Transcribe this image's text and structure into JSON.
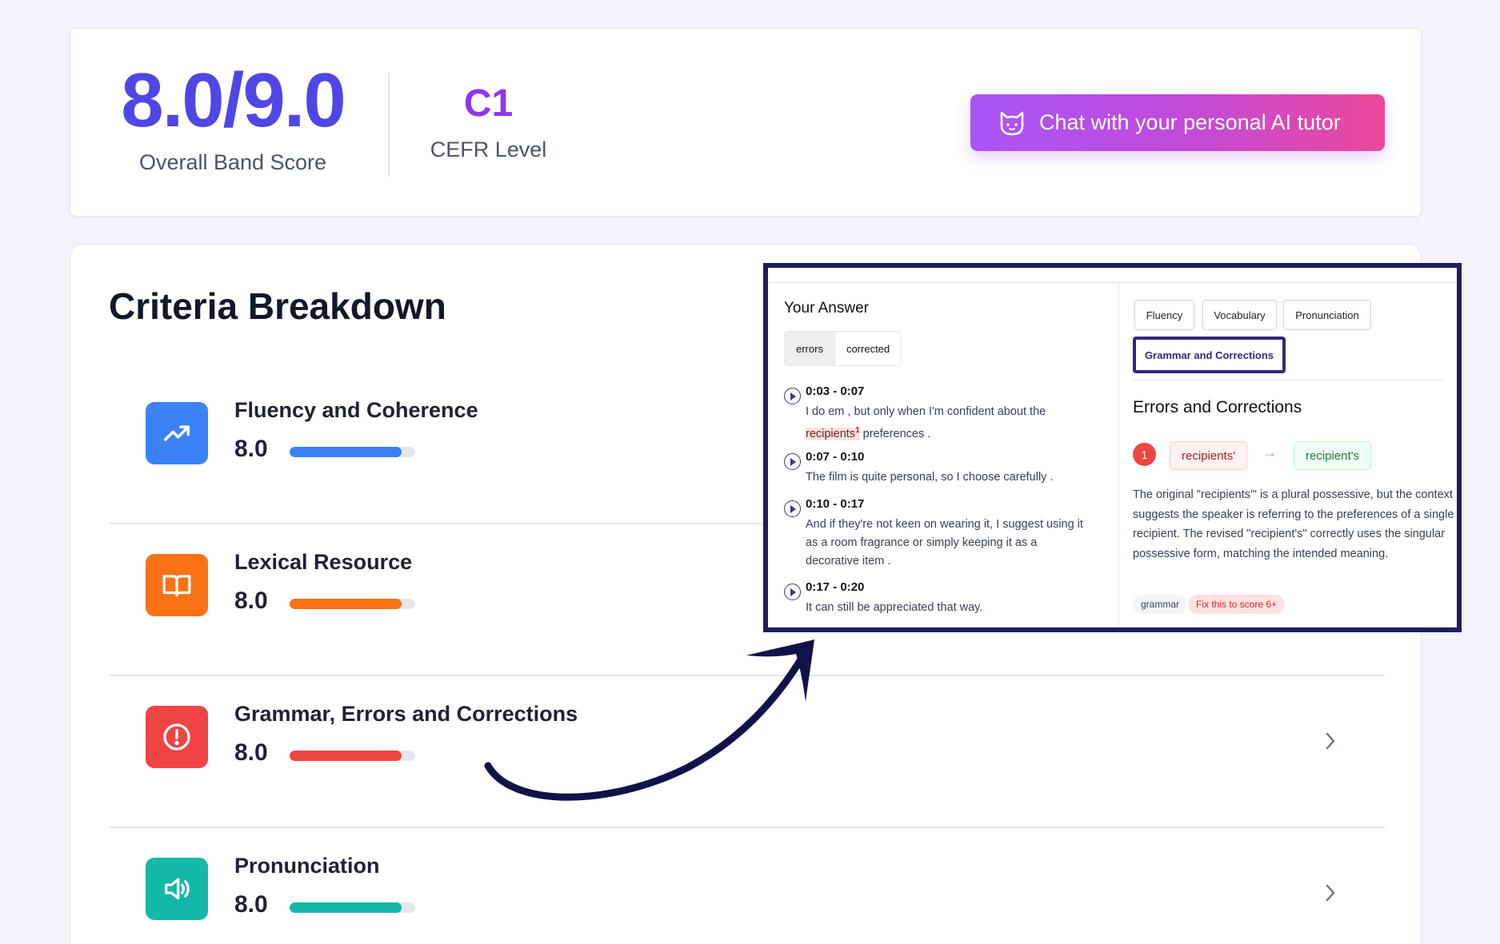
{
  "score_card": {
    "band_value": "8.0/9.0",
    "band_label": "Overall Band Score",
    "cefr_value": "C1",
    "cefr_label": "CEFR Level",
    "tutor_button_label": "Chat with your personal AI tutor"
  },
  "criteria": {
    "title": "Criteria Breakdown",
    "items": [
      {
        "name": "Fluency and Coherence",
        "score": "8.0",
        "progress_fraction": 0.89,
        "color": "#3b82f6",
        "icon": "trending-up-icon"
      },
      {
        "name": "Lexical Resource",
        "score": "8.0",
        "progress_fraction": 0.89,
        "color": "#f97316",
        "icon": "book-open-icon"
      },
      {
        "name": "Grammar, Errors and Corrections",
        "score": "8.0",
        "progress_fraction": 0.89,
        "color": "#ef4444",
        "icon": "alert-circle-icon"
      },
      {
        "name": "Pronunciation",
        "score": "8.0",
        "progress_fraction": 0.89,
        "color": "#14b8a6",
        "icon": "volume-icon"
      }
    ]
  },
  "inset": {
    "answer_title": "Your Answer",
    "toggle": {
      "errors": "errors",
      "corrected": "corrected"
    },
    "segments": [
      {
        "time": "0:03 - 0:07",
        "text_before": "I do     em , but only when I'm confident about the",
        "highlight": "recipients",
        "footnote": "1",
        "text_after": " preferences     ."
      },
      {
        "time": "0:07 - 0:10",
        "text": "The film is quite personal, so I choose carefully    ."
      },
      {
        "time": "0:10 - 0:17",
        "text": "And if they're not keen on wearing it, I suggest using it as a room fragrance or simply keeping it as a decorative     item    ."
      },
      {
        "time": "0:17 - 0:20",
        "text": "It can still be     appreciated that way."
      }
    ],
    "tabs": [
      "Fluency",
      "Vocabulary",
      "Pronunciation",
      "Grammar and Corrections"
    ],
    "panel_title": "Errors and Corrections",
    "correction": {
      "number": "1",
      "original": "recipients'",
      "corrected": "recipient's",
      "explanation": "The original \"recipients'\" is a plural possessive, but the context suggests the speaker is referring to the preferences of a single recipient. The revised \"recipient's\" correctly uses the singular possessive form, matching the intended meaning.",
      "tag_category": "grammar",
      "tag_action": "Fix this to score 6+"
    }
  }
}
